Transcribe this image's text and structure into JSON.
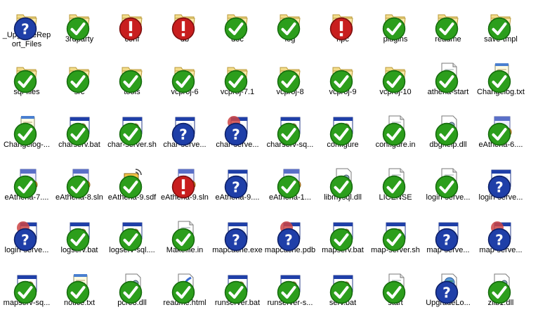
{
  "window": {
    "title": ""
  },
  "colors": {
    "background": "#ffffff",
    "check_green": "#2c9e1c",
    "error_red": "#c81e1e",
    "question_blue": "#1f3fa8",
    "folder_yellow": "#f3dc8a"
  },
  "items": [
    {
      "label": "_UpgradeReport_Files",
      "icon": "folder",
      "badge": "question"
    },
    {
      "label": "3rdparty",
      "icon": "folder",
      "badge": "check"
    },
    {
      "label": "conf",
      "icon": "folder",
      "badge": "error"
    },
    {
      "label": "db",
      "icon": "folder",
      "badge": "error"
    },
    {
      "label": "doc",
      "icon": "folder",
      "badge": "check"
    },
    {
      "label": "log",
      "icon": "folder",
      "badge": "check"
    },
    {
      "label": "npc",
      "icon": "folder",
      "badge": "error"
    },
    {
      "label": "plugins",
      "icon": "folder",
      "badge": "check"
    },
    {
      "label": "readme",
      "icon": "folder",
      "badge": "check"
    },
    {
      "label": "save-tmpl",
      "icon": "folder",
      "badge": "check"
    },
    {
      "label": "sql-files",
      "icon": "folder",
      "badge": "check"
    },
    {
      "label": "src",
      "icon": "folder",
      "badge": "check"
    },
    {
      "label": "tools",
      "icon": "folder",
      "badge": "check"
    },
    {
      "label": "vcproj-6",
      "icon": "folder",
      "badge": "check"
    },
    {
      "label": "vcproj-7.1",
      "icon": "folder",
      "badge": "check"
    },
    {
      "label": "vcproj-8",
      "icon": "folder",
      "badge": "check"
    },
    {
      "label": "vcproj-9",
      "icon": "folder",
      "badge": "check"
    },
    {
      "label": "vcproj-10",
      "icon": "folder",
      "badge": "check"
    },
    {
      "label": "athena-start",
      "icon": "doc",
      "badge": "check"
    },
    {
      "label": "Changelog.txt",
      "icon": "notepad",
      "badge": "check"
    },
    {
      "label": "Changelog-...",
      "icon": "notepad",
      "badge": "check"
    },
    {
      "label": "charserv.bat",
      "icon": "batch",
      "badge": "check"
    },
    {
      "label": "char-server.sh",
      "icon": "batch",
      "badge": "check"
    },
    {
      "label": "char-serve...",
      "icon": "window",
      "badge": "question"
    },
    {
      "label": "char-serve...",
      "icon": "ball-window",
      "badge": "question"
    },
    {
      "label": "charserv-sq...",
      "icon": "batch",
      "badge": "check"
    },
    {
      "label": "configure",
      "icon": "batch",
      "badge": "check"
    },
    {
      "label": "configure.in",
      "icon": "doc",
      "badge": "check"
    },
    {
      "label": "dbghelp.dll",
      "icon": "dll",
      "badge": "check"
    },
    {
      "label": "eAthena-6....",
      "icon": "vsproj",
      "badge": "check"
    },
    {
      "label": "eAthena-7....",
      "icon": "vsproj7",
      "badge": "check"
    },
    {
      "label": "eAthena-8.sln",
      "icon": "vsproj8",
      "badge": "check"
    },
    {
      "label": "eAthena-9.sdf",
      "icon": "sdf",
      "badge": "check"
    },
    {
      "label": "eAthena-9.sln",
      "icon": "vsproj10",
      "badge": "error"
    },
    {
      "label": "eAthena-9....",
      "icon": "window",
      "badge": "question"
    },
    {
      "label": "eAthena-1...",
      "icon": "vsproj10",
      "badge": "check"
    },
    {
      "label": "libmysql.dll",
      "icon": "dll",
      "badge": "check"
    },
    {
      "label": "LICENSE",
      "icon": "doc",
      "badge": "check"
    },
    {
      "label": "login-serve...",
      "icon": "doc",
      "badge": "check"
    },
    {
      "label": "login-serve...",
      "icon": "window",
      "badge": "question"
    },
    {
      "label": "login-serve...",
      "icon": "ball-window",
      "badge": "question"
    },
    {
      "label": "logserv.bat",
      "icon": "batch",
      "badge": "check"
    },
    {
      "label": "logserv-sql....",
      "icon": "batch",
      "badge": "check"
    },
    {
      "label": "Makefile.in",
      "icon": "doc",
      "badge": "check"
    },
    {
      "label": "mapcache.exe",
      "icon": "window",
      "badge": "question"
    },
    {
      "label": "mapcache.pdb",
      "icon": "ball-window",
      "badge": "question"
    },
    {
      "label": "mapserv.bat",
      "icon": "batch",
      "badge": "check"
    },
    {
      "label": "map-server.sh",
      "icon": "batch",
      "badge": "check"
    },
    {
      "label": "map-serve...",
      "icon": "window",
      "badge": "question"
    },
    {
      "label": "map-serve...",
      "icon": "ball-window",
      "badge": "question"
    },
    {
      "label": "mapserv-sq...",
      "icon": "batch",
      "badge": "check"
    },
    {
      "label": "notice.txt",
      "icon": "notepad",
      "badge": "check"
    },
    {
      "label": "pcre3.dll",
      "icon": "dll",
      "badge": "check"
    },
    {
      "label": "readme.html",
      "icon": "html",
      "badge": "check"
    },
    {
      "label": "runserver.bat",
      "icon": "batch",
      "badge": "check"
    },
    {
      "label": "runserver-s...",
      "icon": "batch",
      "badge": "check"
    },
    {
      "label": "serv.bat",
      "icon": "batch",
      "badge": "check"
    },
    {
      "label": "start",
      "icon": "doc",
      "badge": "check"
    },
    {
      "label": "UpgradeLo...",
      "icon": "globe-doc",
      "badge": "question"
    },
    {
      "label": "zlib1.dll",
      "icon": "dll",
      "badge": "check"
    }
  ]
}
